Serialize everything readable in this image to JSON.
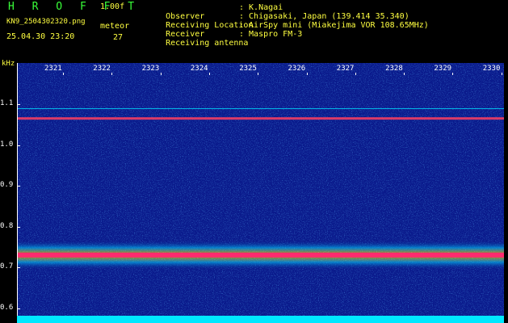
{
  "header": {
    "app_title": "H R O F F T",
    "version": "1.00f",
    "filename": "KN9_2504302320.png",
    "meteor_label": "meteor",
    "datetime": "25.04.30 23:20",
    "meteor_count": "27"
  },
  "info": {
    "rows": [
      {
        "label": "Observer",
        "value": ": K.Nagai"
      },
      {
        "label": "Receiving Location",
        "value": ": Chigasaki, Japan (139.414 35.340)"
      },
      {
        "label": "Receiver",
        "value": ": AirSpy mini (Miakejima VOR 108.65MHz)"
      },
      {
        "label": "Receiving antenna",
        "value": ": Maspro FM-3"
      }
    ]
  },
  "axes": {
    "unit": "kHz",
    "freq_labels": [
      "1.1",
      "1.0",
      "0.9",
      "0.8",
      "0.7",
      "0.6"
    ],
    "time_labels": [
      "2321",
      "2322",
      "2323",
      "2324",
      "2325",
      "2326",
      "2327",
      "2328",
      "2329",
      "2330"
    ]
  },
  "colors": {
    "title": "#39ff39",
    "label_yellow": "#ffff40",
    "text_white": "#ffffff",
    "background": "#000000",
    "plot_base": "#0a1a8c",
    "strong_band": "#ff2a6e",
    "weak_band": "#ff4060",
    "baseline": "#00e8ff"
  },
  "spectrogram": {
    "strong_band_khz": 0.73,
    "weak_band_khz": 1.065,
    "line_band_khz": 1.09
  }
}
